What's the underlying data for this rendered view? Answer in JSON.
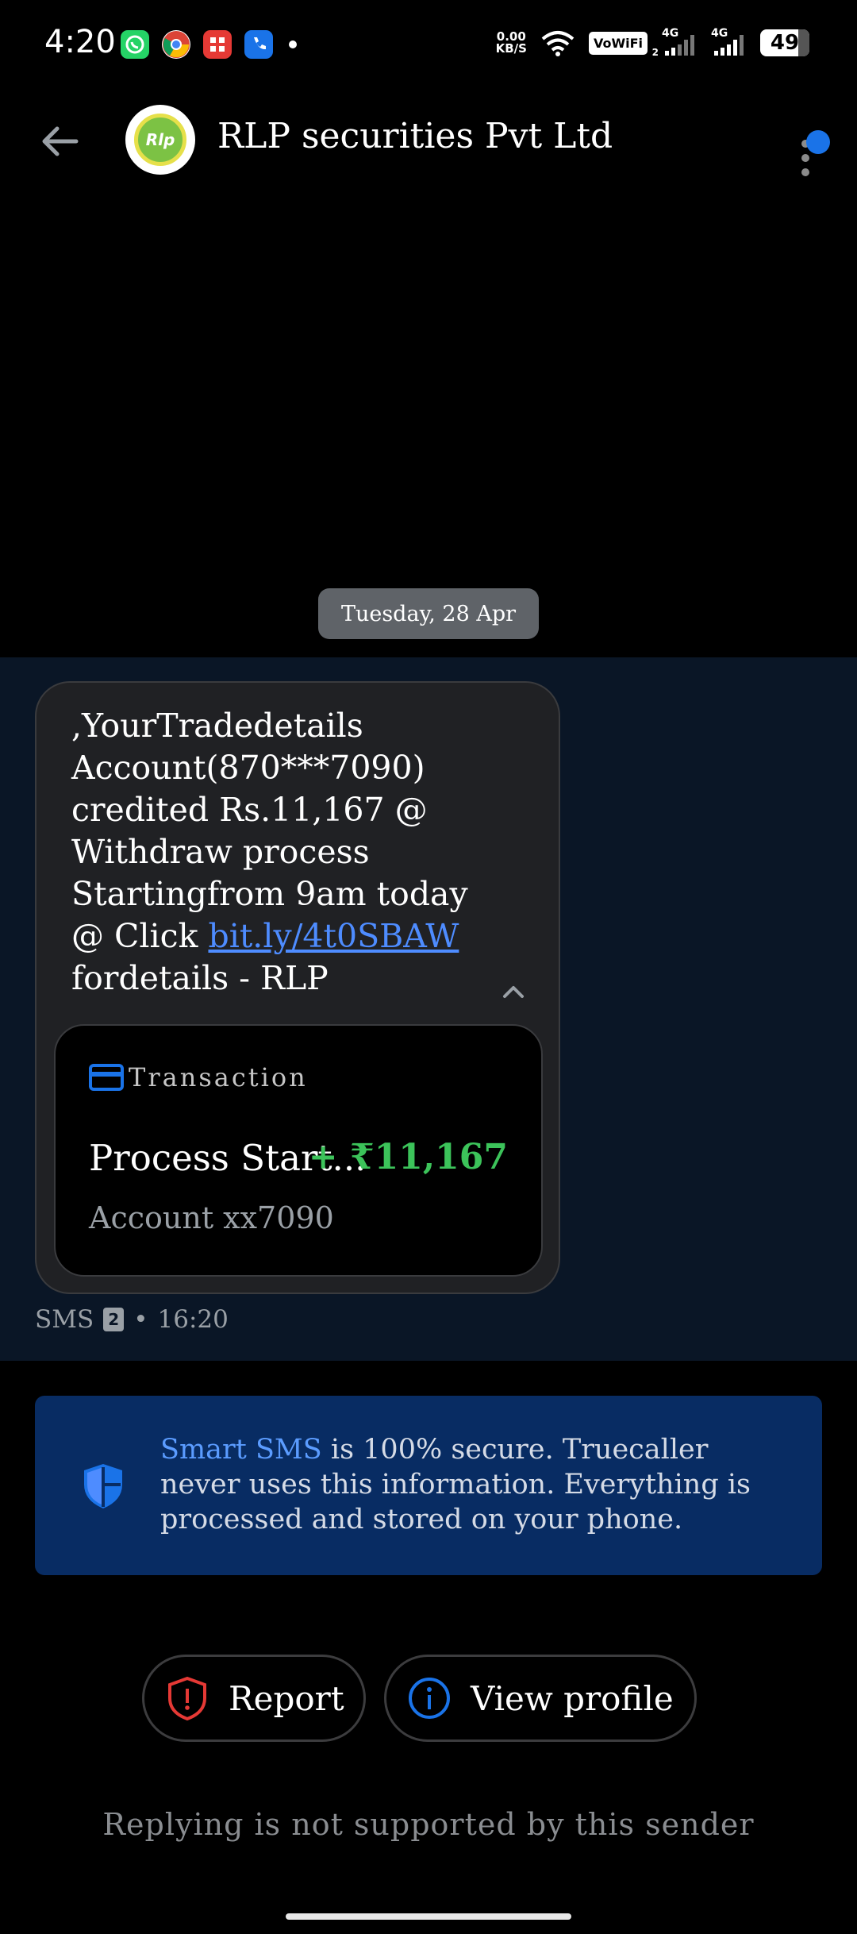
{
  "status_bar": {
    "time": "4:20",
    "net_speed_value": "0.00",
    "net_speed_unit": "KB/S",
    "vowifi": "VoWiFi",
    "vowifi_sim": "2",
    "signal1_label": "4G",
    "signal2_label": "4G",
    "battery": "49",
    "app_icons": [
      "whatsapp-icon",
      "chrome-icon",
      "calculator-icon",
      "phone-app-icon"
    ]
  },
  "header": {
    "title": "RLP securities Pvt Ltd",
    "avatar_text": "Rlp"
  },
  "conversation": {
    "date_chip": "Tuesday, 28 Apr",
    "message": {
      "text_before_link": ",YourTradedetails\nAccount(870***7090)\ncredited Rs.11,167 @\nWithdraw process\nStartingfrom 9am today\n@ Click ",
      "link": "bit.ly/4t0SBAW",
      "text_after_link": "\nfordetails - RLP"
    },
    "transaction": {
      "label": "Transaction",
      "title": "Process Start...",
      "amount": "+ ₹11,167",
      "account": "Account xx7090"
    },
    "meta": {
      "channel": "SMS",
      "sim": "2",
      "separator": "•",
      "time": "16:20"
    }
  },
  "info": {
    "highlight": "Smart SMS",
    "text": " is 100% secure. Truecaller never uses this information. Everything is processed and stored on your phone."
  },
  "actions": {
    "report": "Report",
    "view_profile": "View profile"
  },
  "footer": {
    "no_reply": "Replying is not supported by this sender"
  },
  "colors": {
    "accent_blue": "#1a73e8",
    "link_blue": "#4e8cff",
    "amount_green": "#3cc35a",
    "report_red": "#e53935",
    "info_bg": "#082c63"
  }
}
